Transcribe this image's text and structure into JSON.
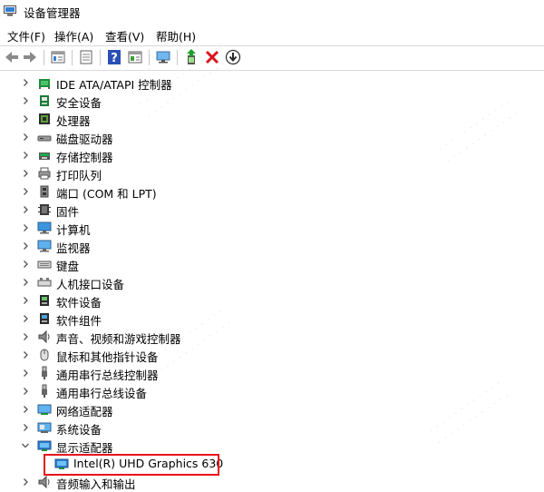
{
  "window": {
    "title": "设备管理器"
  },
  "menu": [
    {
      "label": "文件(F)"
    },
    {
      "label": "操作(A)"
    },
    {
      "label": "查看(V)"
    },
    {
      "label": "帮助(H)"
    }
  ],
  "toolbar": [
    {
      "icon": "back-arrow-icon"
    },
    {
      "icon": "forward-arrow-icon"
    },
    {
      "icon": "properties-icon"
    },
    {
      "icon": "show-hidden-icon"
    },
    {
      "icon": "help-icon"
    },
    {
      "icon": "console-view-icon"
    },
    {
      "icon": "monitor-scan-icon"
    },
    {
      "icon": "update-driver-icon"
    },
    {
      "icon": "uninstall-icon"
    },
    {
      "icon": "download-icon"
    }
  ],
  "tree": {
    "rows": [
      {
        "label": "IDE ATA/ATAPI 控制器",
        "icon": "ide-controller-icon",
        "expanded": false
      },
      {
        "label": "安全设备",
        "icon": "security-device-icon",
        "expanded": false
      },
      {
        "label": "处理器",
        "icon": "processor-icon",
        "expanded": false
      },
      {
        "label": "磁盘驱动器",
        "icon": "disk-drive-icon",
        "expanded": false
      },
      {
        "label": "存储控制器",
        "icon": "storage-controller-icon",
        "expanded": false
      },
      {
        "label": "打印队列",
        "icon": "printer-icon",
        "expanded": false
      },
      {
        "label": "端口 (COM 和 LPT)",
        "icon": "port-icon",
        "expanded": false
      },
      {
        "label": "固件",
        "icon": "firmware-icon",
        "expanded": false
      },
      {
        "label": "计算机",
        "icon": "computer-icon",
        "expanded": false
      },
      {
        "label": "监视器",
        "icon": "monitor-icon",
        "expanded": false
      },
      {
        "label": "键盘",
        "icon": "keyboard-icon",
        "expanded": false
      },
      {
        "label": "人机接口设备",
        "icon": "hid-icon",
        "expanded": false
      },
      {
        "label": "软件设备",
        "icon": "software-device-icon",
        "expanded": false
      },
      {
        "label": "软件组件",
        "icon": "software-component-icon",
        "expanded": false
      },
      {
        "label": "声音、视频和游戏控制器",
        "icon": "speaker-icon",
        "expanded": false
      },
      {
        "label": "鼠标和其他指针设备",
        "icon": "mouse-icon",
        "expanded": false
      },
      {
        "label": "通用串行总线控制器",
        "icon": "usb-icon",
        "expanded": false
      },
      {
        "label": "通用串行总线设备",
        "icon": "usb-icon",
        "expanded": false
      },
      {
        "label": "网络适配器",
        "icon": "network-adapter-icon",
        "expanded": false
      },
      {
        "label": "系统设备",
        "icon": "system-device-icon",
        "expanded": false
      },
      {
        "label": "显示适配器",
        "icon": "display-adapter-icon",
        "expanded": true
      },
      {
        "label": "Intel(R) UHD Graphics 630",
        "icon": "display-adapter-icon",
        "child": true,
        "selected": true
      },
      {
        "label": "音频输入和输出",
        "icon": "audio-io-icon",
        "expanded": false
      }
    ]
  },
  "colors": {
    "highlight_border": "#e8141c",
    "uninstall_red": "#d9141c",
    "help_blue": "#2a4fb5"
  }
}
